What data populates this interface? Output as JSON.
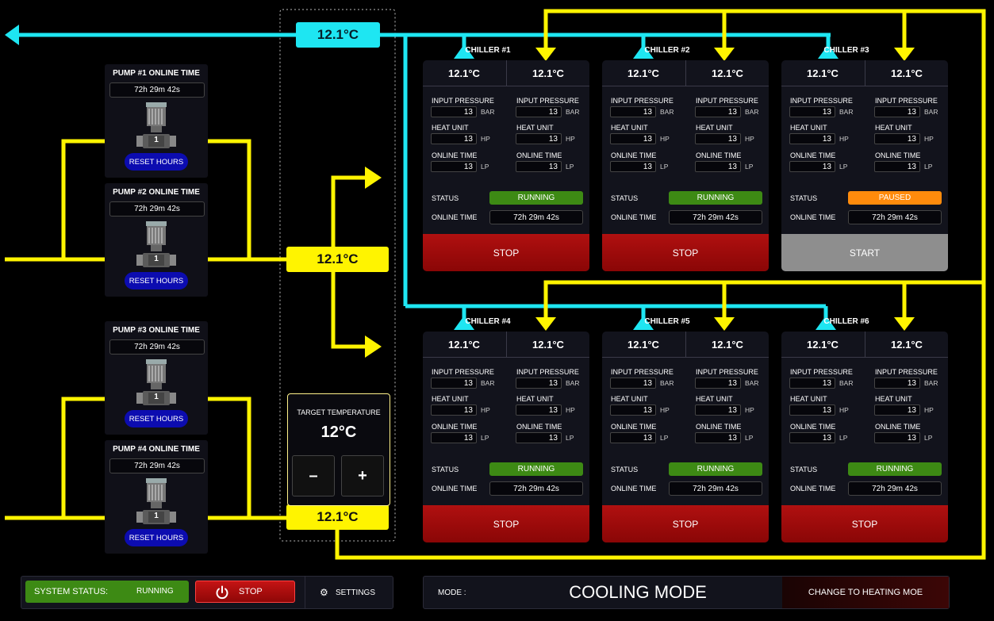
{
  "badges": {
    "outflow": "12.1°C",
    "inflow": "12.1°C",
    "return": "12.1°C"
  },
  "pumps": [
    {
      "title": "PUMP #1 ONLINE TIME",
      "time": "72h  29m  42s",
      "num": "1",
      "reset": "RESET HOURS"
    },
    {
      "title": "PUMP #2 ONLINE TIME",
      "time": "72h  29m  42s",
      "num": "1",
      "reset": "RESET HOURS"
    },
    {
      "title": "PUMP #3 ONLINE TIME",
      "time": "72h  29m  42s",
      "num": "1",
      "reset": "RESET HOURS"
    },
    {
      "title": "PUMP #4 ONLINE TIME",
      "time": "72h  29m  42s",
      "num": "1",
      "reset": "RESET HOURS"
    }
  ],
  "labels": {
    "input_pressure": "INPUT PRESSURE",
    "heat_unit": "HEAT UNIT",
    "online_time": "ONLINE TIME",
    "status": "STATUS",
    "bar": "BAR",
    "hp": "HP",
    "lp": "LP"
  },
  "chillers": [
    {
      "name": "CHILLER #1",
      "t_out": "12.1°C",
      "t_in": "12.1°C",
      "pressure_a": "13",
      "pressure_b": "13",
      "heat_a": "13",
      "heat_b": "13",
      "online_a": "13",
      "online_b": "13",
      "status": "RUNNING",
      "online_time": "72h  29m  42s",
      "button": "STOP"
    },
    {
      "name": "CHILLER #2",
      "t_out": "12.1°C",
      "t_in": "12.1°C",
      "pressure_a": "13",
      "pressure_b": "13",
      "heat_a": "13",
      "heat_b": "13",
      "online_a": "13",
      "online_b": "13",
      "status": "RUNNING",
      "online_time": "72h  29m  42s",
      "button": "STOP"
    },
    {
      "name": "CHILLER #3",
      "t_out": "12.1°C",
      "t_in": "12.1°C",
      "pressure_a": "13",
      "pressure_b": "13",
      "heat_a": "13",
      "heat_b": "13",
      "online_a": "13",
      "online_b": "13",
      "status": "PAUSED",
      "online_time": "72h  29m  42s",
      "button": "START"
    },
    {
      "name": "CHILLER #4",
      "t_out": "12.1°C",
      "t_in": "12.1°C",
      "pressure_a": "13",
      "pressure_b": "13",
      "heat_a": "13",
      "heat_b": "13",
      "online_a": "13",
      "online_b": "13",
      "status": "RUNNING",
      "online_time": "72h  29m  42s",
      "button": "STOP"
    },
    {
      "name": "CHILLER #5",
      "t_out": "12.1°C",
      "t_in": "12.1°C",
      "pressure_a": "13",
      "pressure_b": "13",
      "heat_a": "13",
      "heat_b": "13",
      "online_a": "13",
      "online_b": "13",
      "status": "RUNNING",
      "online_time": "72h  29m  42s",
      "button": "STOP"
    },
    {
      "name": "CHILLER #6",
      "t_out": "12.1°C",
      "t_in": "12.1°C",
      "pressure_a": "13",
      "pressure_b": "13",
      "heat_a": "13",
      "heat_b": "13",
      "online_a": "13",
      "online_b": "13",
      "status": "RUNNING",
      "online_time": "72h  29m  42s",
      "button": "STOP"
    }
  ],
  "target": {
    "label": "TARGET TEMPERATURE",
    "value": "12°C",
    "minus": "–",
    "plus": "+"
  },
  "system": {
    "status_label": "SYSTEM STATUS:",
    "status_value": "RUNNING",
    "stop_label": "STOP",
    "settings_label": "SETTINGS"
  },
  "mode": {
    "label": "MODE :",
    "value": "COOLING MODE",
    "change_label": "CHANGE TO HEATING MOE"
  },
  "colors": {
    "cold_pipe": "#1ee6f2",
    "warm_pipe": "#fff400",
    "running": "#3d8a14",
    "paused": "#ff8b0c",
    "stop": "#b01010",
    "reset": "#0c0cb0"
  },
  "icons": [
    "power-icon",
    "gear-icon",
    "pump-icon",
    "arrow-up-icon",
    "arrow-down-icon"
  ]
}
